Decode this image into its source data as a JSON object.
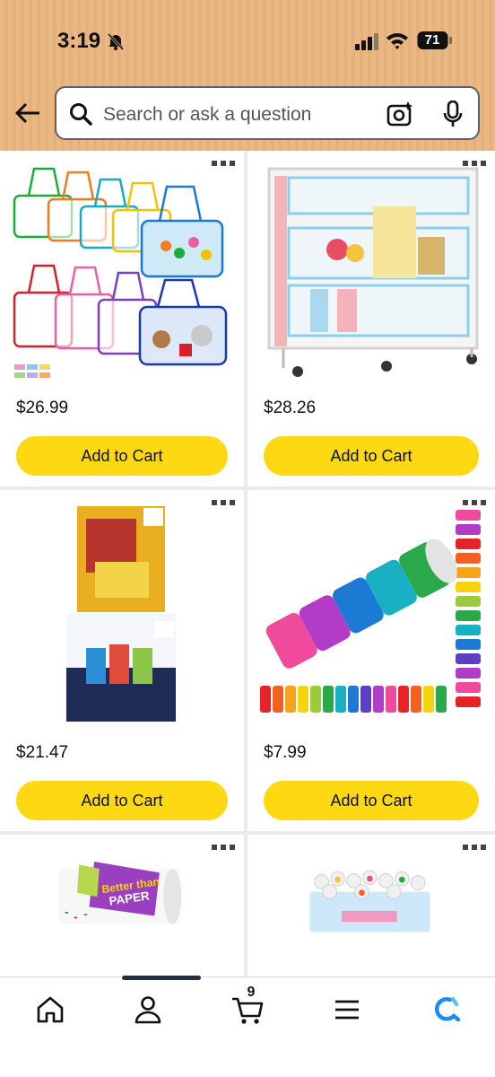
{
  "status_bar": {
    "time": "3:19",
    "battery_level": "71"
  },
  "search": {
    "placeholder": "Search or ask a question"
  },
  "products": [
    {
      "price": "$26.99",
      "cta": "Add to Cart",
      "image": "colorful zip storage bags"
    },
    {
      "price": "$28.26",
      "cta": "Add to Cart",
      "image": "rolling classroom storage cart"
    },
    {
      "price": "$21.47",
      "cta": "Add to Cart",
      "image": "snack variety pack boxes"
    },
    {
      "price": "$7.99",
      "cta": "Add to Cart",
      "image": "crayon bulletin board border"
    },
    {
      "price": "",
      "cta": "",
      "image": "Better Than Paper roll"
    },
    {
      "price": "",
      "cta": "",
      "image": "toy capsules bin"
    }
  ],
  "bottom_nav": {
    "cart_count": "9",
    "items": [
      "home-icon",
      "account-icon",
      "cart-icon",
      "menu-icon",
      "rufus-icon"
    ]
  },
  "colors": {
    "header_bg": "#eab883",
    "cta_yellow": "#ffd814",
    "accent_blue": "#1a8cff"
  }
}
